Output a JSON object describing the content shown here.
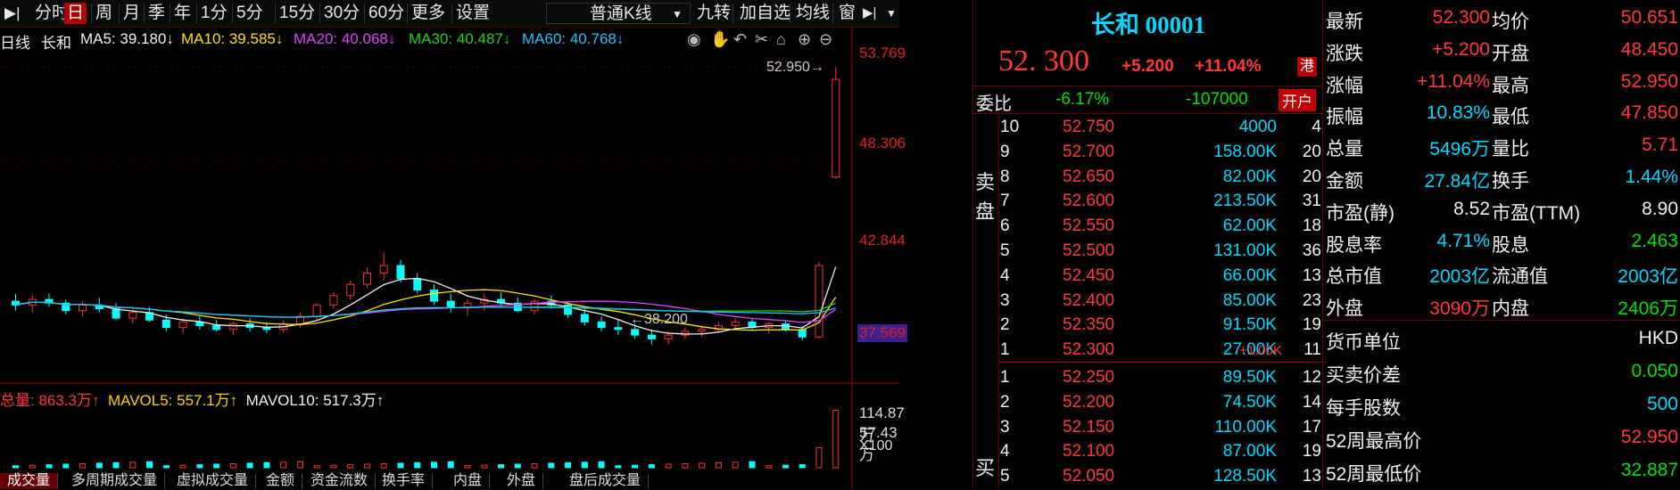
{
  "toolbar": {
    "items": [
      "分时",
      "日",
      "周",
      "月",
      "季",
      "年",
      "1分",
      "5分",
      "15分",
      "30分",
      "60分",
      "更多",
      "设置"
    ],
    "selected": "日",
    "kline_select": "普通K线",
    "right_items": [
      "九转",
      "加自选",
      "均线",
      "窗"
    ]
  },
  "chart": {
    "period_label": "日线",
    "stock_name": "长和",
    "ma": [
      {
        "label": "MA5: 39.180↓",
        "color": "#f0f0f0"
      },
      {
        "label": "MA10: 39.585↓",
        "color": "#ffe000"
      },
      {
        "label": "MA20: 40.068↓",
        "color": "#e040ff"
      },
      {
        "label": "MA30: 40.487↓",
        "color": "#20d020"
      },
      {
        "label": "MA60: 40.768↓",
        "color": "#20c0ff"
      }
    ],
    "price_axis": [
      "53.769",
      "48.306",
      "42.844",
      "37.569"
    ],
    "high_annotation": "52.950",
    "low_annotation": "38.200",
    "volume_label": "总量: 863.3万↑",
    "mavol5": "MAVOL5: 557.1万↑",
    "mavol10": "MAVOL10: 517.3万↑",
    "volume_axis": [
      "114.87万",
      "57.43万",
      "X100"
    ],
    "bottom_tabs": [
      "成交量",
      "多周期成交量",
      "虚拟成交量",
      "金额",
      "资金流数",
      "换手率",
      "内盘",
      "外盘",
      "盘后成交量"
    ]
  },
  "chart_data": {
    "type": "candlestick",
    "ylim": [
      37.569,
      53.769
    ],
    "candles": [
      [
        40.5,
        40.9,
        40.0,
        40.3
      ],
      [
        40.3,
        40.8,
        39.9,
        40.6
      ],
      [
        40.6,
        40.9,
        40.2,
        40.4
      ],
      [
        40.4,
        40.6,
        39.8,
        40.0
      ],
      [
        40.0,
        40.5,
        39.7,
        40.3
      ],
      [
        40.3,
        40.7,
        39.9,
        40.1
      ],
      [
        40.1,
        40.4,
        39.5,
        39.6
      ],
      [
        39.6,
        40.1,
        39.3,
        39.9
      ],
      [
        39.9,
        40.2,
        39.4,
        39.5
      ],
      [
        39.5,
        39.8,
        38.9,
        39.1
      ],
      [
        39.1,
        39.6,
        38.8,
        39.4
      ],
      [
        39.4,
        39.7,
        39.0,
        39.2
      ],
      [
        39.2,
        39.5,
        38.9,
        39.0
      ],
      [
        39.0,
        39.4,
        38.7,
        39.3
      ],
      [
        39.3,
        39.6,
        38.9,
        39.1
      ],
      [
        39.1,
        39.4,
        38.8,
        39.0
      ],
      [
        39.0,
        39.5,
        38.8,
        39.3
      ],
      [
        39.3,
        39.9,
        39.1,
        39.7
      ],
      [
        39.7,
        40.4,
        39.5,
        40.3
      ],
      [
        40.3,
        41.0,
        40.1,
        40.8
      ],
      [
        40.8,
        41.6,
        40.6,
        41.4
      ],
      [
        41.4,
        42.3,
        41.2,
        42.0
      ],
      [
        42.0,
        43.1,
        41.6,
        42.4
      ],
      [
        42.4,
        42.7,
        41.5,
        41.7
      ],
      [
        41.7,
        42.0,
        40.9,
        41.1
      ],
      [
        41.1,
        41.4,
        40.3,
        40.5
      ],
      [
        40.5,
        40.9,
        39.9,
        40.2
      ],
      [
        40.2,
        40.6,
        39.7,
        40.4
      ],
      [
        40.4,
        40.9,
        40.0,
        40.6
      ],
      [
        40.6,
        41.0,
        40.2,
        40.4
      ],
      [
        40.4,
        40.7,
        39.9,
        40.0
      ],
      [
        40.0,
        40.6,
        39.8,
        40.5
      ],
      [
        40.5,
        40.8,
        40.1,
        40.3
      ],
      [
        40.3,
        40.5,
        39.6,
        39.8
      ],
      [
        39.8,
        40.1,
        39.2,
        39.4
      ],
      [
        39.4,
        39.7,
        38.9,
        39.1
      ],
      [
        39.1,
        39.5,
        38.7,
        39.0
      ],
      [
        39.0,
        39.3,
        38.5,
        38.7
      ],
      [
        38.7,
        39.0,
        38.2,
        38.5
      ],
      [
        38.5,
        38.9,
        38.2,
        38.7
      ],
      [
        38.7,
        39.1,
        38.5,
        38.9
      ],
      [
        38.9,
        39.2,
        38.6,
        39.0
      ],
      [
        39.0,
        39.4,
        38.8,
        39.2
      ],
      [
        39.2,
        39.6,
        39.0,
        39.4
      ],
      [
        39.4,
        39.6,
        39.0,
        39.1
      ],
      [
        39.1,
        39.4,
        38.8,
        39.3
      ],
      [
        39.3,
        39.5,
        38.9,
        39.0
      ],
      [
        39.0,
        39.2,
        38.4,
        38.6
      ],
      [
        38.6,
        42.6,
        38.5,
        42.4
      ],
      [
        47.1,
        52.95,
        47.0,
        52.3
      ]
    ],
    "volume_ylim": [
      0,
      114.87
    ]
  },
  "quote": {
    "title": "长和 00001",
    "price": "52. 300",
    "change": "+5.200",
    "change_pct": "+11.04%",
    "market_badge": "港",
    "weibi_label": "委比",
    "weibi_pct": "-6.17%",
    "weibi_diff": "-107000",
    "open_account_btn": "开户",
    "sell_label": [
      "卖",
      "盘"
    ],
    "buy_label": "买",
    "sells": [
      {
        "lvl": "10",
        "price": "52.750",
        "vol": "4000",
        "n": "4",
        "extra": ""
      },
      {
        "lvl": "9",
        "price": "52.700",
        "vol": "158.00K",
        "n": "20",
        "extra": ""
      },
      {
        "lvl": "8",
        "price": "52.650",
        "vol": "82.00K",
        "n": "20",
        "extra": ""
      },
      {
        "lvl": "7",
        "price": "52.600",
        "vol": "213.50K",
        "n": "31",
        "extra": ""
      },
      {
        "lvl": "6",
        "price": "52.550",
        "vol": "62.00K",
        "n": "18",
        "extra": ""
      },
      {
        "lvl": "5",
        "price": "52.500",
        "vol": "131.00K",
        "n": "36",
        "extra": ""
      },
      {
        "lvl": "4",
        "price": "52.450",
        "vol": "66.00K",
        "n": "13",
        "extra": ""
      },
      {
        "lvl": "3",
        "price": "52.400",
        "vol": "85.00K",
        "n": "23",
        "extra": ""
      },
      {
        "lvl": "2",
        "price": "52.350",
        "vol": "91.50K",
        "n": "19",
        "extra": ""
      },
      {
        "lvl": "1",
        "price": "52.300",
        "vol": "27.00K",
        "n": "11",
        "extra": "+1.00K"
      }
    ],
    "buys": [
      {
        "lvl": "1",
        "price": "52.250",
        "vol": "89.50K",
        "n": "12"
      },
      {
        "lvl": "2",
        "price": "52.200",
        "vol": "74.50K",
        "n": "14"
      },
      {
        "lvl": "3",
        "price": "52.150",
        "vol": "110.00K",
        "n": "17"
      },
      {
        "lvl": "4",
        "price": "52.100",
        "vol": "87.00K",
        "n": "19"
      },
      {
        "lvl": "5",
        "price": "52.050",
        "vol": "128.50K",
        "n": "13"
      }
    ]
  },
  "stats": [
    {
      "l1": "最新",
      "v1": "52.300",
      "c1": "red",
      "l2": "均价",
      "v2": "50.651",
      "c2": "red"
    },
    {
      "l1": "涨跌",
      "v1": "+5.200",
      "c1": "red",
      "l2": "开盘",
      "v2": "48.450",
      "c2": "red"
    },
    {
      "l1": "涨幅",
      "v1": "+11.04%",
      "c1": "red",
      "l2": "最高",
      "v2": "52.950",
      "c2": "red"
    },
    {
      "l1": "振幅",
      "v1": "10.83%",
      "c1": "cyan",
      "l2": "最低",
      "v2": "47.850",
      "c2": "red"
    },
    {
      "l1": "总量",
      "v1": "5496万",
      "c1": "cyan",
      "l2": "量比",
      "v2": "5.71",
      "c2": "red"
    },
    {
      "l1": "金额",
      "v1": "27.84亿",
      "c1": "cyan",
      "l2": "换手",
      "v2": "1.44%",
      "c2": "cyan"
    },
    {
      "l1": "市盈(静)",
      "v1": "8.52",
      "c1": "white",
      "l2": "市盈(TTM)",
      "v2": "8.90",
      "c2": "white"
    },
    {
      "l1": "股息率",
      "v1": "4.71%",
      "c1": "cyan",
      "l2": "股息",
      "v2": "2.463",
      "c2": "green"
    },
    {
      "l1": "总市值",
      "v1": "2003亿",
      "c1": "cyan",
      "l2": "流通值",
      "v2": "2003亿",
      "c2": "cyan"
    },
    {
      "l1": "外盘",
      "v1": "3090万",
      "c1": "red",
      "l2": "内盘",
      "v2": "2406万",
      "c2": "green"
    }
  ],
  "stats2": [
    {
      "l": "货币单位",
      "v": "HKD",
      "c": "white"
    },
    {
      "l": "买卖价差",
      "v": "0.050",
      "c": "green"
    },
    {
      "l": "每手股数",
      "v": "500",
      "c": "cyan"
    },
    {
      "l": "52周最高价",
      "v": "52.950",
      "c": "red"
    },
    {
      "l": "52周最低价",
      "v": "32.887",
      "c": "green"
    }
  ]
}
